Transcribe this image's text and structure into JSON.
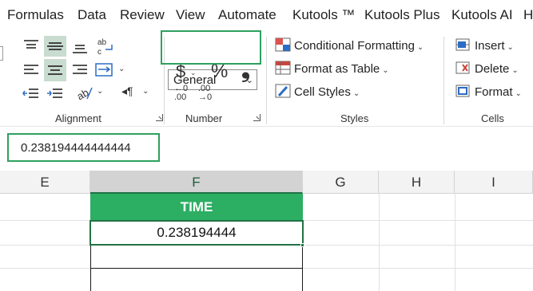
{
  "tabs": [
    "Formulas",
    "Data",
    "Review",
    "View",
    "Automate",
    "Kutools ™",
    "Kutools Plus",
    "Kutools AI",
    "He"
  ],
  "ribbon": {
    "alignment": {
      "label": "Alignment",
      "wrap_icon": "wrap-text-icon"
    },
    "number": {
      "label": "Number",
      "format_value": "General",
      "currency_symbol": "$",
      "percent_symbol": "%",
      "comma_symbol": "❟",
      "dec_inc_top": "←0",
      "dec_inc_bottom": ".00",
      "dec_dec_top": ".00",
      "dec_dec_bottom": "→0"
    },
    "styles": {
      "label": "Styles",
      "conditional": "Conditional Formatting",
      "format_table": "Format as Table",
      "cell_styles": "Cell Styles"
    },
    "cells": {
      "label": "Cells",
      "insert": "Insert",
      "delete": "Delete",
      "format": "Format"
    }
  },
  "formula_bar": {
    "value": "0.238194444444444"
  },
  "grid": {
    "columns": [
      "E",
      "F",
      "G",
      "H",
      "I"
    ],
    "header_cell": "TIME",
    "value_cell": "0.238194444"
  },
  "colors": {
    "accent": "#2ea05f",
    "header_fill": "#2cae63",
    "excel_green": "#217346"
  }
}
